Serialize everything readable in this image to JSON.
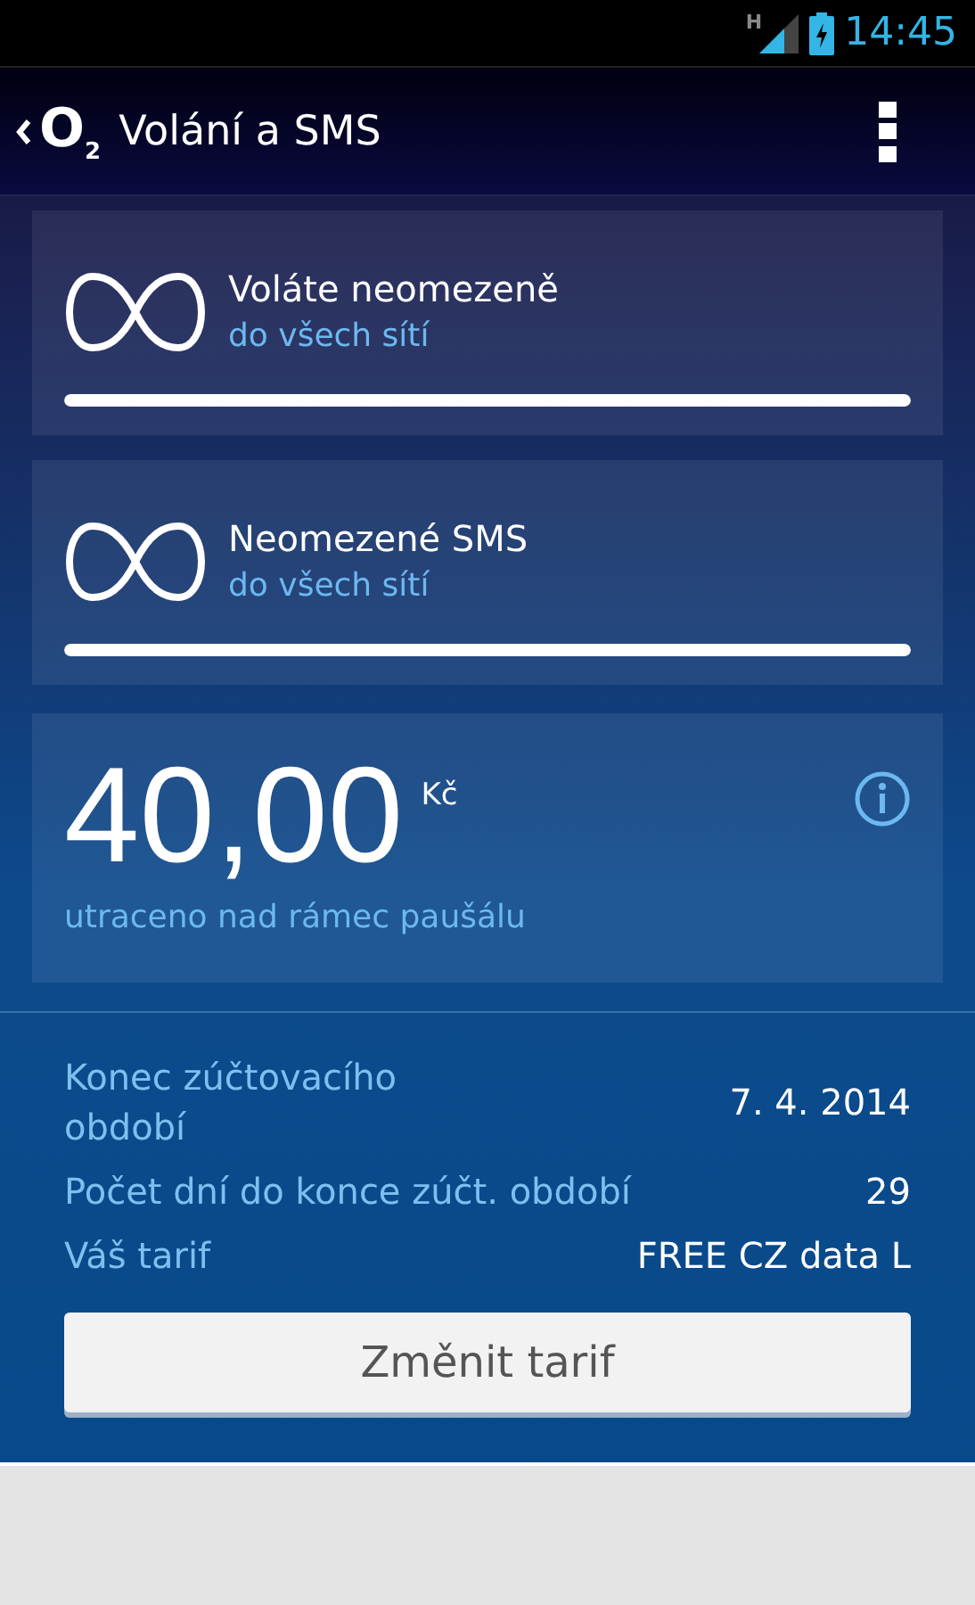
{
  "status_bar": {
    "network": "H",
    "time": "14:45"
  },
  "app_bar": {
    "logo": "O$_{2}$",
    "title": "Volání a SMS"
  },
  "allowances": [
    {
      "title": "Voláte neomezeně",
      "subtitle": "do všech sítí",
      "level": 1
    },
    {
      "title": "Neomezené SMS",
      "subtitle": "do všech sítí",
      "level": 1
    }
  ],
  "spend": {
    "amount": "40,00",
    "currency": "Kč",
    "caption": "utraceno nad rámec paušálu"
  },
  "details": [
    {
      "label": "Konec zúčtovacího období",
      "value": "7. 4. 2014"
    },
    {
      "label": "Počet dní do konce zúčt. období",
      "value": "29"
    },
    {
      "label": "Váš tarif",
      "value": "FREE CZ data L"
    }
  ],
  "button": "Změnit tarif"
}
